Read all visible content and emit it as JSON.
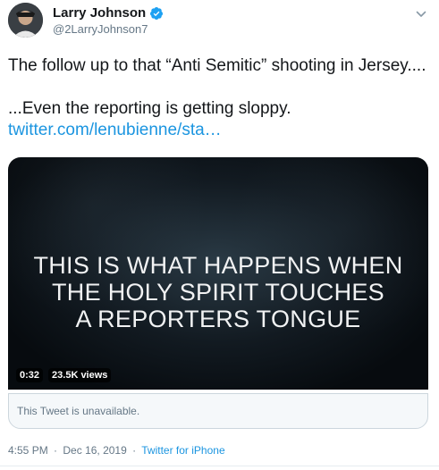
{
  "author": {
    "display_name": "Larry Johnson",
    "handle": "@2LarryJohnson7",
    "verified_icon": "verified-badge-icon",
    "accent": "#1da1f2"
  },
  "tweet": {
    "line1": "The follow up to that “Anti Semitic” shooting in Jersey....",
    "line2": "...Even the reporting is getting sloppy.",
    "link": "twitter.com/lenubienne/sta…"
  },
  "media": {
    "overlay_lines": [
      "THIS IS WHAT HAPPENS WHEN",
      "THE HOLY SPIRIT TOUCHES",
      "A REPORTERS TONGUE"
    ],
    "duration": "0:32",
    "views": "23.5K views"
  },
  "quoted": {
    "unavailable_text": "This Tweet is unavailable."
  },
  "meta": {
    "time": "4:55 PM",
    "separator": "·",
    "date": "Dec 16, 2019",
    "source": "Twitter for iPhone",
    "link_color": "#1b95e0"
  }
}
